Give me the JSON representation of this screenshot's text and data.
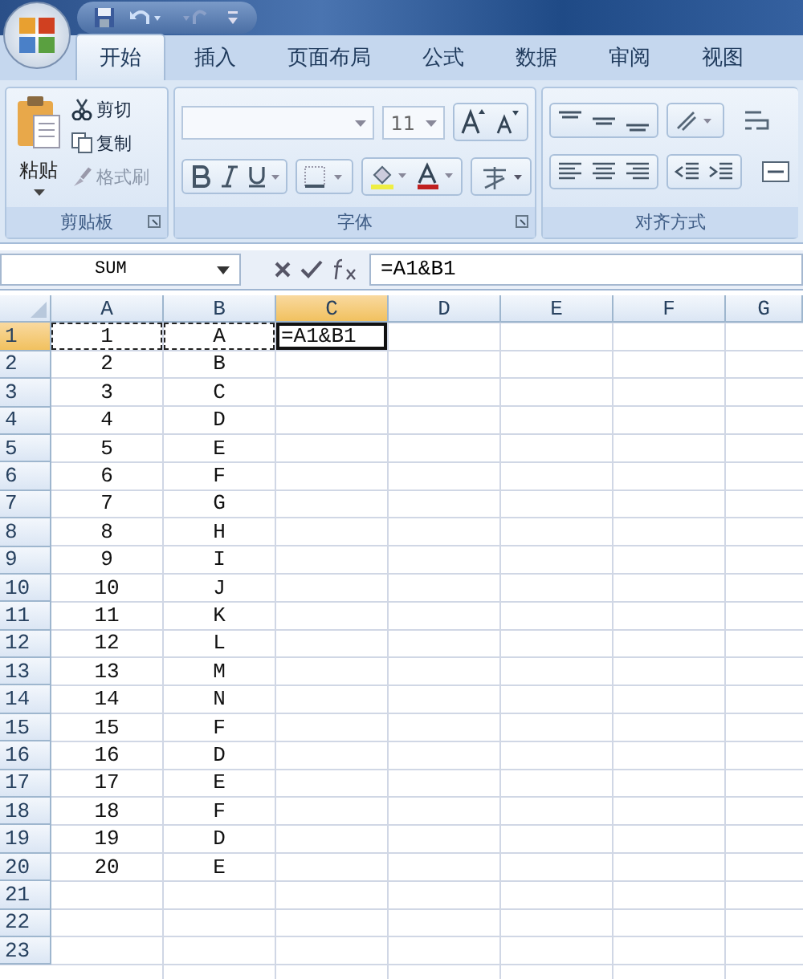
{
  "tabs": [
    {
      "label": "开始",
      "selected": true
    },
    {
      "label": "插入",
      "selected": false
    },
    {
      "label": "页面布局",
      "selected": false
    },
    {
      "label": "公式",
      "selected": false
    },
    {
      "label": "数据",
      "selected": false
    },
    {
      "label": "审阅",
      "selected": false
    },
    {
      "label": "视图",
      "selected": false
    }
  ],
  "clipboard": {
    "paste": "粘贴",
    "cut": "剪切",
    "copy": "复制",
    "format_painter": {
      "label": "格式刷",
      "disabled": true
    },
    "label": "剪贴板"
  },
  "font": {
    "font_size": "11",
    "label": "字体"
  },
  "alignment": {
    "label": "对齐方式"
  },
  "formula_bar": {
    "name_box": "SUM",
    "formula": "=A1&B1"
  },
  "columns": [
    {
      "label": "A",
      "selected": false
    },
    {
      "label": "B",
      "selected": false
    },
    {
      "label": "C",
      "selected": true
    },
    {
      "label": "D",
      "selected": false
    },
    {
      "label": "E",
      "selected": false
    },
    {
      "label": "F",
      "selected": false
    },
    {
      "label": "G",
      "selected": false
    }
  ],
  "rows": [
    {
      "label": "1",
      "selected": true,
      "cells": [
        {
          "text": "1",
          "referenced": true,
          "active": false
        },
        {
          "text": "A",
          "referenced": true,
          "active": false
        },
        {
          "text": "=A1&B1",
          "referenced": false,
          "active": true
        }
      ]
    },
    {
      "label": "2",
      "selected": false,
      "cells": [
        {
          "text": "2",
          "referenced": false,
          "active": false
        },
        {
          "text": "B",
          "referenced": false,
          "active": false
        }
      ]
    },
    {
      "label": "3",
      "selected": false,
      "cells": [
        {
          "text": "3",
          "referenced": false,
          "active": false
        },
        {
          "text": "C",
          "referenced": false,
          "active": false
        }
      ]
    },
    {
      "label": "4",
      "selected": false,
      "cells": [
        {
          "text": "4",
          "referenced": false,
          "active": false
        },
        {
          "text": "D",
          "referenced": false,
          "active": false
        }
      ]
    },
    {
      "label": "5",
      "selected": false,
      "cells": [
        {
          "text": "5",
          "referenced": false,
          "active": false
        },
        {
          "text": "E",
          "referenced": false,
          "active": false
        }
      ]
    },
    {
      "label": "6",
      "selected": false,
      "cells": [
        {
          "text": "6",
          "referenced": false,
          "active": false
        },
        {
          "text": "F",
          "referenced": false,
          "active": false
        }
      ]
    },
    {
      "label": "7",
      "selected": false,
      "cells": [
        {
          "text": "7",
          "referenced": false,
          "active": false
        },
        {
          "text": "G",
          "referenced": false,
          "active": false
        }
      ]
    },
    {
      "label": "8",
      "selected": false,
      "cells": [
        {
          "text": "8",
          "referenced": false,
          "active": false
        },
        {
          "text": "H",
          "referenced": false,
          "active": false
        }
      ]
    },
    {
      "label": "9",
      "selected": false,
      "cells": [
        {
          "text": "9",
          "referenced": false,
          "active": false
        },
        {
          "text": "I",
          "referenced": false,
          "active": false
        }
      ]
    },
    {
      "label": "10",
      "selected": false,
      "cells": [
        {
          "text": "10",
          "referenced": false,
          "active": false
        },
        {
          "text": "J",
          "referenced": false,
          "active": false
        }
      ]
    },
    {
      "label": "11",
      "selected": false,
      "cells": [
        {
          "text": "11",
          "referenced": false,
          "active": false
        },
        {
          "text": "K",
          "referenced": false,
          "active": false
        }
      ]
    },
    {
      "label": "12",
      "selected": false,
      "cells": [
        {
          "text": "12",
          "referenced": false,
          "active": false
        },
        {
          "text": "L",
          "referenced": false,
          "active": false
        }
      ]
    },
    {
      "label": "13",
      "selected": false,
      "cells": [
        {
          "text": "13",
          "referenced": false,
          "active": false
        },
        {
          "text": "M",
          "referenced": false,
          "active": false
        }
      ]
    },
    {
      "label": "14",
      "selected": false,
      "cells": [
        {
          "text": "14",
          "referenced": false,
          "active": false
        },
        {
          "text": "N",
          "referenced": false,
          "active": false
        }
      ]
    },
    {
      "label": "15",
      "selected": false,
      "cells": [
        {
          "text": "15",
          "referenced": false,
          "active": false
        },
        {
          "text": "F",
          "referenced": false,
          "active": false
        }
      ]
    },
    {
      "label": "16",
      "selected": false,
      "cells": [
        {
          "text": "16",
          "referenced": false,
          "active": false
        },
        {
          "text": "D",
          "referenced": false,
          "active": false
        }
      ]
    },
    {
      "label": "17",
      "selected": false,
      "cells": [
        {
          "text": "17",
          "referenced": false,
          "active": false
        },
        {
          "text": "E",
          "referenced": false,
          "active": false
        }
      ]
    },
    {
      "label": "18",
      "selected": false,
      "cells": [
        {
          "text": "18",
          "referenced": false,
          "active": false
        },
        {
          "text": "F",
          "referenced": false,
          "active": false
        }
      ]
    },
    {
      "label": "19",
      "selected": false,
      "cells": [
        {
          "text": "19",
          "referenced": false,
          "active": false
        },
        {
          "text": "D",
          "referenced": false,
          "active": false
        }
      ]
    },
    {
      "label": "20",
      "selected": false,
      "cells": [
        {
          "text": "20",
          "referenced": false,
          "active": false
        },
        {
          "text": "E",
          "referenced": false,
          "active": false
        }
      ]
    },
    {
      "label": "21",
      "selected": false
    },
    {
      "label": "22",
      "selected": false
    },
    {
      "label": "23",
      "selected": false
    }
  ]
}
